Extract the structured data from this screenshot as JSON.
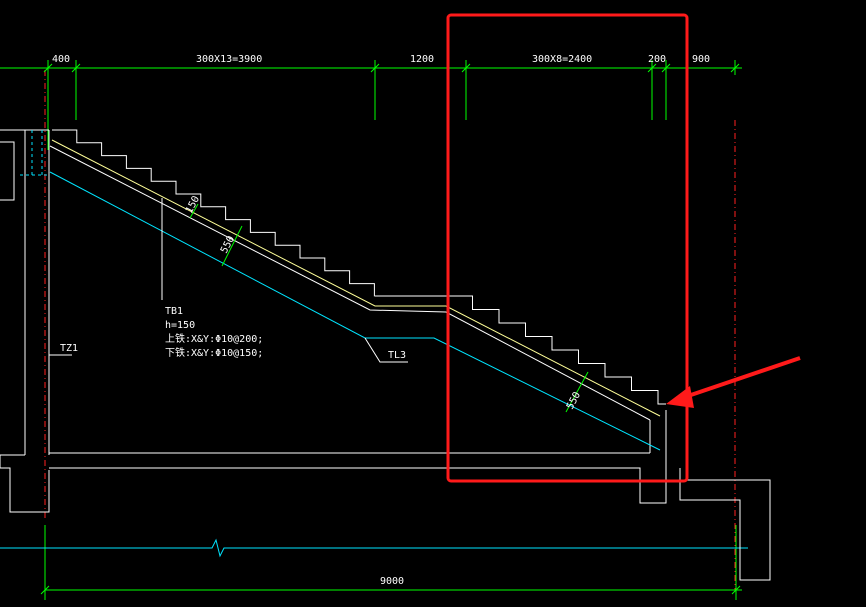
{
  "drawing": {
    "top_dimensions": [
      {
        "id": "d400",
        "label": "400"
      },
      {
        "id": "d3900",
        "label": "300X13=3900"
      },
      {
        "id": "d1200",
        "label": "1200"
      },
      {
        "id": "d2400",
        "label": "300X8=2400"
      },
      {
        "id": "d200",
        "label": "200"
      },
      {
        "id": "d900",
        "label": "900"
      }
    ],
    "bottom_dimension": {
      "label": "9000"
    },
    "slab_thickness_labels": {
      "a": "150",
      "b": "550",
      "c": "550"
    },
    "column_tag": "TZ1",
    "beam_tag": "TL3",
    "slab_note": {
      "line1": "TB1",
      "line2": "h=150",
      "line3": "上铁:X&Y:Φ10@200;",
      "line4": "下铁:X&Y:Φ10@150;"
    },
    "colors": {
      "background": "#000000",
      "outline": "#ffffff",
      "dimension": "#00ff00",
      "soffit": "#00e5ff",
      "stair_inner": "#ffff99",
      "axis": "#ff2020",
      "highlight": "#ff1a1a"
    }
  }
}
